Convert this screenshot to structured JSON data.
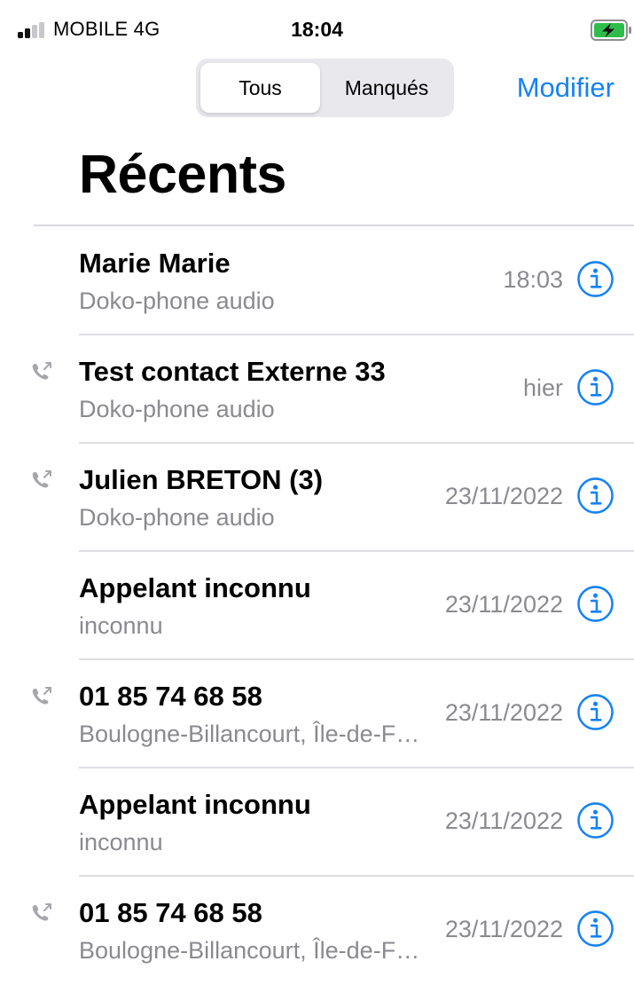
{
  "status_bar": {
    "carrier": "MOBILE  4G",
    "time": "18:04",
    "signal_icon": "signal-bars-icon",
    "battery_icon": "battery-charging-icon",
    "battery_color": "#2ebd4b"
  },
  "header": {
    "segments": [
      {
        "label": "Tous",
        "selected": true
      },
      {
        "label": "Manqués",
        "selected": false
      }
    ],
    "edit_label": "Modifier",
    "title": "Récents"
  },
  "colors": {
    "accent": "#1682f5",
    "secondary_text": "#8a8a8f",
    "outgoing_icon": "#a6a6ab"
  },
  "calls": [
    {
      "name": "Marie Marie",
      "subtitle": "Doko-phone audio",
      "time": "18:03",
      "outgoing": false
    },
    {
      "name": "Test contact  Externe 33",
      "subtitle": "Doko-phone audio",
      "time": "hier",
      "outgoing": true
    },
    {
      "name": "Julien BRETON (3)",
      "subtitle": "Doko-phone audio",
      "time": "23/11/2022",
      "outgoing": true
    },
    {
      "name": "Appelant inconnu",
      "subtitle": "inconnu",
      "time": "23/11/2022",
      "outgoing": false
    },
    {
      "name": "01 85 74 68 58",
      "subtitle": "Boulogne-Billancourt, Île-de-France",
      "time": "23/11/2022",
      "outgoing": true
    },
    {
      "name": "Appelant inconnu",
      "subtitle": "inconnu",
      "time": "23/11/2022",
      "outgoing": false
    },
    {
      "name": "01 85 74 68 58",
      "subtitle": "Boulogne-Billancourt, Île-de-France",
      "time": "23/11/2022",
      "outgoing": true
    }
  ]
}
